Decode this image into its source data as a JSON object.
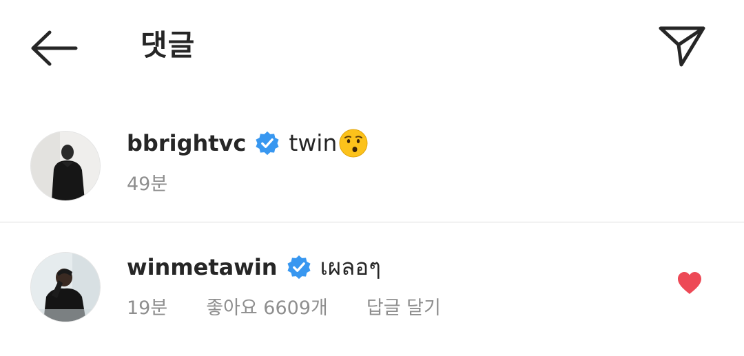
{
  "header": {
    "title": "댓글",
    "back_icon": "arrow-left-icon",
    "share_icon": "paper-plane-icon"
  },
  "comments": [
    {
      "username": "bbrightvc",
      "verified": true,
      "text": "twin",
      "emoji": "kissing-face-emoji",
      "time": "49분",
      "likes": "",
      "reply": ""
    },
    {
      "username": "winmetawin",
      "verified": true,
      "text": "เผลอๆ",
      "time": "19분",
      "likes": "좋아요 6609개",
      "reply": "답글 달기",
      "liked": true
    }
  ],
  "colors": {
    "verified_blue": "#3897f0",
    "like_red": "#ed4956",
    "meta_gray": "#8e8e8e",
    "text": "#262626",
    "divider": "#dbdbdb"
  }
}
